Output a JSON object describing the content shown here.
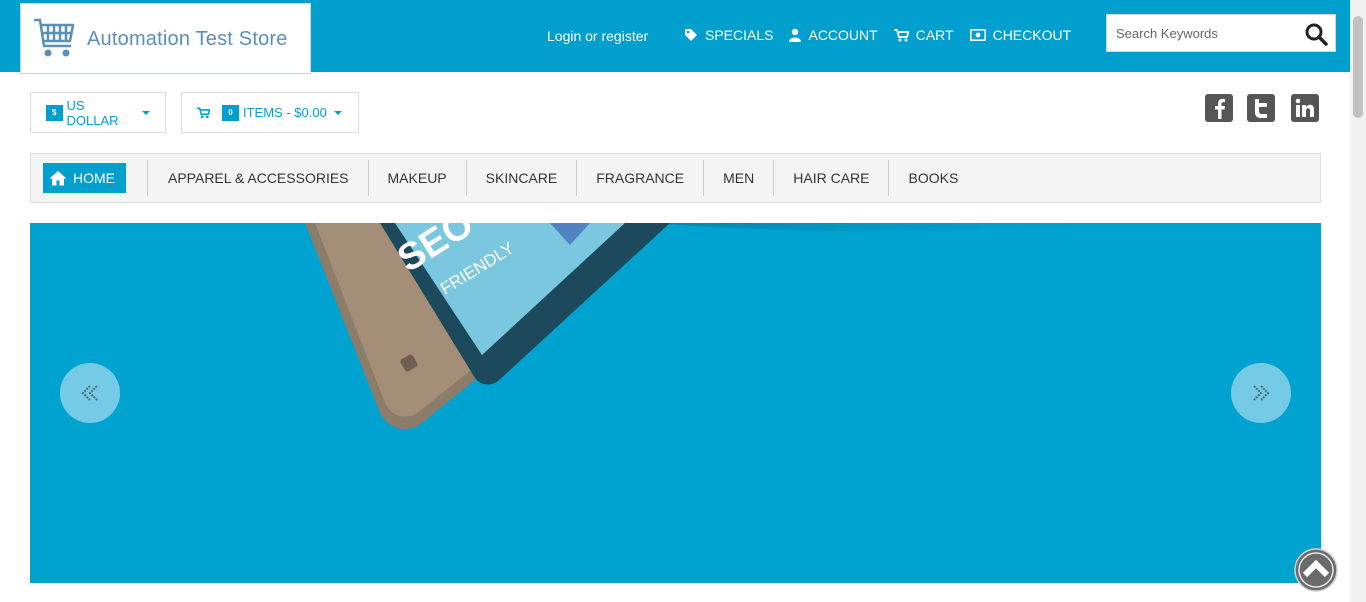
{
  "header": {
    "logo_text": "Automation Test Store",
    "login_link": "Login or register",
    "nav": [
      {
        "label": "SPECIALS",
        "icon": "tag-icon"
      },
      {
        "label": "ACCOUNT",
        "icon": "user-icon"
      },
      {
        "label": "CART",
        "icon": "cart-icon"
      },
      {
        "label": "CHECKOUT",
        "icon": "money-icon"
      }
    ],
    "search": {
      "placeholder": "Search Keywords",
      "value": ""
    }
  },
  "toolbar": {
    "currency_symbol": "$",
    "currency_label": "US DOLLAR",
    "cart_count": "0",
    "cart_label": "ITEMS - $0.00"
  },
  "social": [
    "facebook-icon",
    "twitter-icon",
    "linkedin-icon"
  ],
  "menu": {
    "home": "HOME",
    "categories": [
      "APPAREL & ACCESSORIES",
      "MAKEUP",
      "SKINCARE",
      "FRAGRANCE",
      "MEN",
      "HAIR CARE",
      "BOOKS"
    ]
  },
  "slider": {
    "banner_text_1": "SEO",
    "banner_text_2": "FRIENDLY"
  },
  "colors": {
    "brand": "#009fce",
    "slider_bg": "#00a2d0"
  }
}
